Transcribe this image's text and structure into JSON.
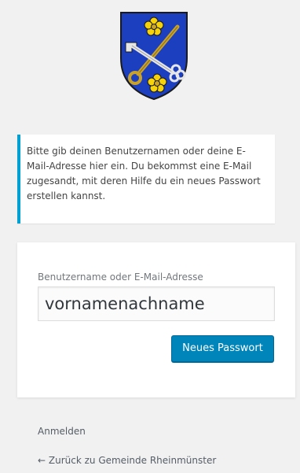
{
  "logo": {
    "name": "coat-of-arms",
    "colors": {
      "shield": "#1c3fbf",
      "stroke": "#1a1a1a",
      "flower": "#f5d20c",
      "metal": "#e6e6e6",
      "gold": "#c9a227"
    }
  },
  "message": {
    "text": "Bitte gib deinen Benutzernamen oder deine E-Mail-Adresse hier ein. Du bekommst eine E-Mail zugesandt, mit deren Hilfe du ein neues Passwort erstellen kannst.",
    "accent_color": "#00a0d2"
  },
  "form": {
    "label": "Benutzername oder E-Mail-Adresse",
    "input_value": "vornamenachname",
    "submit_label": "Neues Passwort",
    "button_color": "#0085ba"
  },
  "nav": {
    "login_label": "Anmelden",
    "back_label": "← Zurück zu Gemeinde Rheinmünster"
  }
}
